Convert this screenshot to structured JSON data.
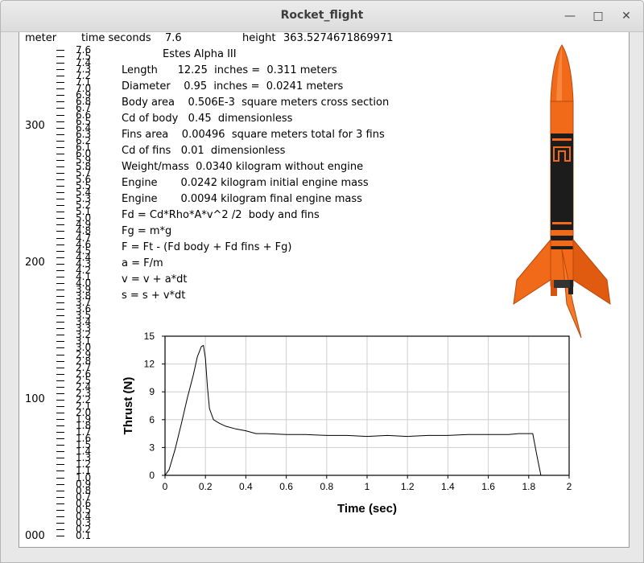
{
  "window": {
    "title": "Rocket_flight",
    "minimize": "—",
    "maximize": "□",
    "close": "✕"
  },
  "header": {
    "unit": "meter",
    "time_label": "time seconds",
    "time_value": "7.6",
    "height_label": "height",
    "height_value": "363.5274671869971"
  },
  "altitude_labels": [
    "300",
    "200",
    "100",
    "000"
  ],
  "velocity_scale": [
    "0.1",
    "0.2",
    "0.3",
    "0.4",
    "0.5",
    "0.6",
    "0.7",
    "0.8",
    "0.9",
    "1.0",
    "1.1",
    "1.2",
    "1.3",
    "1.4",
    "1.5",
    "1.6",
    "1.7",
    "1.8",
    "1.9",
    "2.0",
    "2.1",
    "2.2",
    "2.3",
    "2.4",
    "2.5",
    "2.6",
    "2.7",
    "2.8",
    "2.9",
    "3.0",
    "3.1",
    "3.2",
    "3.3",
    "3.4",
    "3.5",
    "3.6",
    "3.7",
    "3.8",
    "3.9",
    "4.0",
    "4.1",
    "4.2",
    "4.3",
    "4.4",
    "4.5",
    "4.6",
    "4.7",
    "4.8",
    "4.9",
    "5.0",
    "5.1",
    "5.2",
    "5.3",
    "5.4",
    "5.5",
    "5.6",
    "5.7",
    "5.8",
    "5.9",
    "6.0",
    "6.1",
    "6.2",
    "6.3",
    "6.4",
    "6.5",
    "6.6",
    "6.7",
    "6.8",
    "6.9",
    "7.0",
    "7.1",
    "7.2",
    "7.3",
    "7.4",
    "7.5",
    "7.6"
  ],
  "info_lines": [
    "Estes Alpha III",
    "Length      12.25  inches =  0.311 meters",
    "Diameter    0.95  inches =  0.0241 meters",
    "Body area    0.506E-3  square meters cross section",
    "Cd of body   0.45  dimensionless",
    "Fins area    0.00496  square meters total for 3 fins",
    "Cd of fins   0.01  dimensionless",
    "Weight/mass  0.0340 kilogram without engine",
    "Engine       0.0242 kilogram initial engine mass",
    "Engine       0.0094 kilogram final engine mass",
    "Fd = Cd*Rho*A*v^2 /2  body and fins",
    "Fg = m*g",
    "F = Ft - (Fd body + Fd fins + Fg)",
    "a = F/m",
    "v = v + a*dt",
    "s = s + v*dt"
  ],
  "rocket_icon": "rocket-illustration",
  "colors": {
    "rocket_orange": "#f06a1a",
    "rocket_black": "#1c1c1c",
    "grid": "#cfcfcf"
  },
  "chart_data": {
    "type": "line",
    "xlabel": "Time (sec)",
    "ylabel": "Thrust (N)",
    "xlim": [
      0,
      2
    ],
    "ylim": [
      0,
      15
    ],
    "xticks": [
      "0",
      "0.2",
      "0.4",
      "0.6",
      "0.8",
      "1",
      "1.2",
      "1.4",
      "1.6",
      "1.8",
      "2"
    ],
    "yticks": [
      "0",
      "3",
      "6",
      "9",
      "12",
      "15"
    ],
    "grid": true,
    "series": [
      {
        "x": [
          0,
          0.02,
          0.05,
          0.08,
          0.11,
          0.14,
          0.16,
          0.18,
          0.19,
          0.2,
          0.21,
          0.22,
          0.24,
          0.27,
          0.3,
          0.35,
          0.4,
          0.45,
          0.5,
          0.6,
          0.7,
          0.8,
          0.9,
          1.0,
          1.1,
          1.2,
          1.3,
          1.4,
          1.5,
          1.6,
          1.7,
          1.75,
          1.82,
          1.84,
          1.86
        ],
        "y": [
          0,
          0.6,
          2.8,
          5.5,
          8.3,
          10.8,
          12.8,
          13.9,
          14.0,
          12.6,
          9.5,
          7.2,
          6.0,
          5.6,
          5.3,
          5.0,
          4.8,
          4.5,
          4.5,
          4.4,
          4.4,
          4.3,
          4.3,
          4.2,
          4.3,
          4.2,
          4.3,
          4.3,
          4.4,
          4.4,
          4.4,
          4.5,
          4.5,
          2.2,
          0
        ]
      }
    ]
  }
}
